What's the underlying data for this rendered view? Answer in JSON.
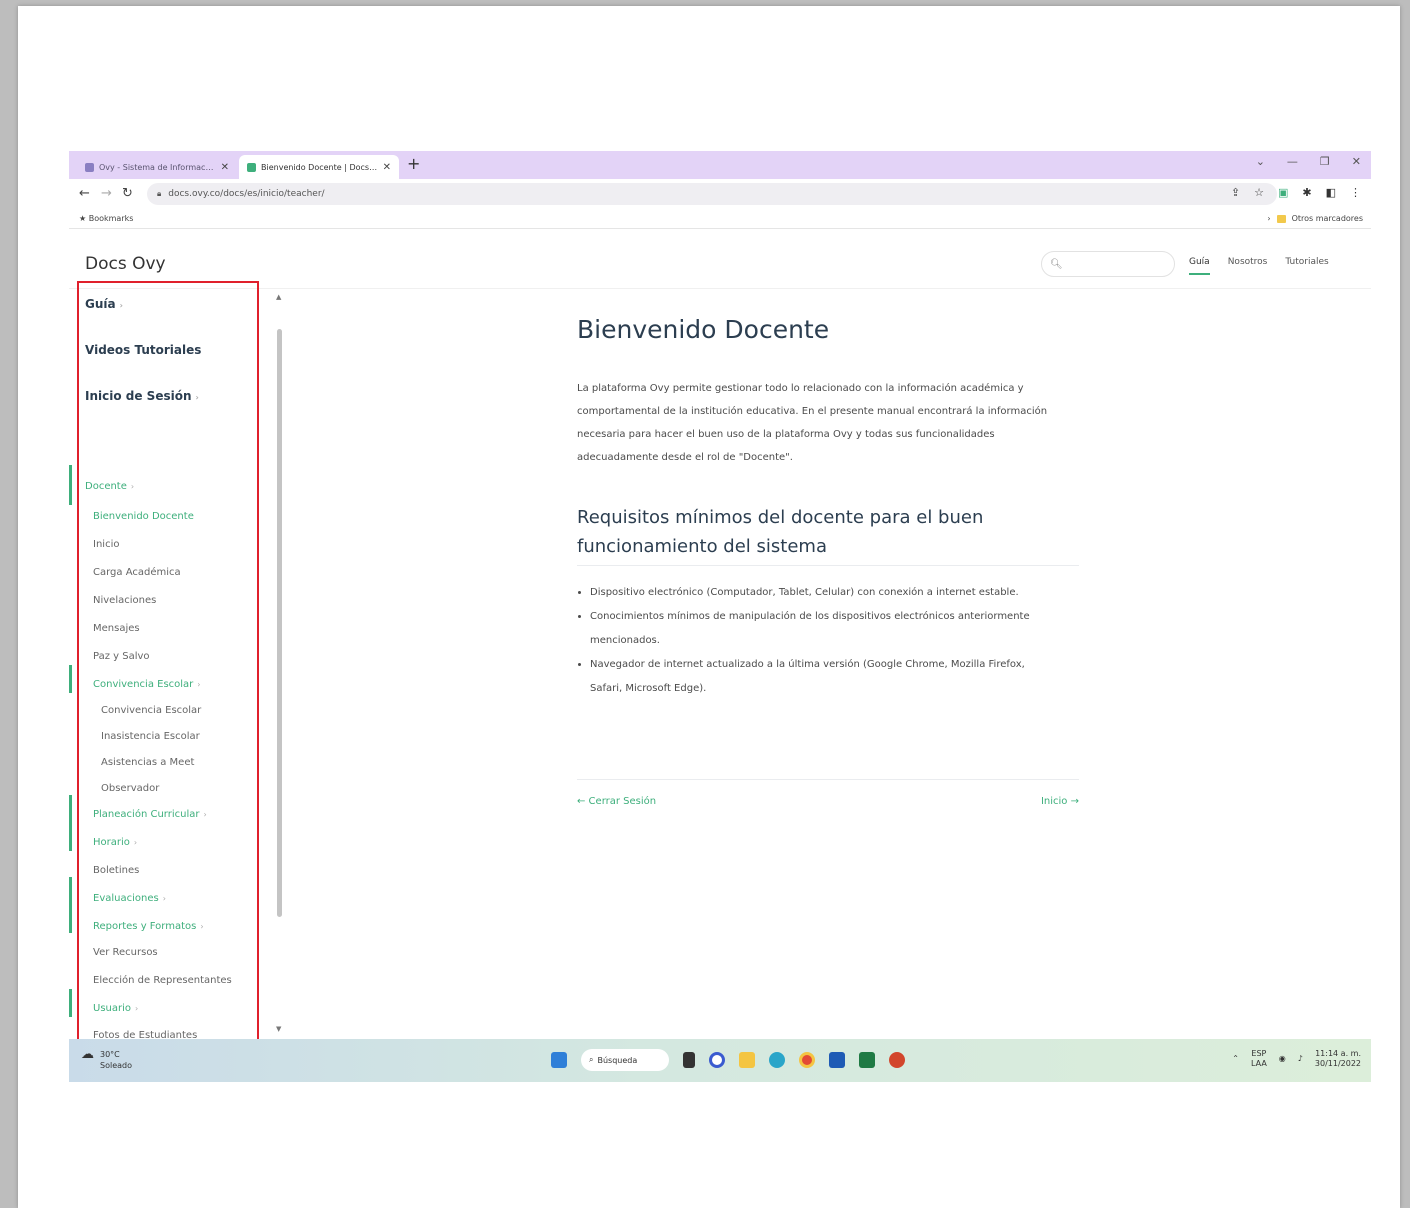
{
  "browser": {
    "tabs": [
      {
        "title": "Ovy - Sistema de Información p",
        "close": "✕"
      },
      {
        "title": "Bienvenido Docente | Docs Ovy",
        "close": "✕"
      }
    ],
    "new_tab": "+",
    "window_controls": [
      "⌄",
      "—",
      "❐",
      "✕"
    ],
    "url": "docs.ovy.co/docs/es/inicio/teacher/",
    "bookmarks_left": "Bookmarks",
    "bookmarks_right": "Otros marcadores"
  },
  "site": {
    "brand": "Docs Ovy",
    "search_placeholder": "",
    "nav": [
      "Guía",
      "Nosotros",
      "Tutoriales"
    ]
  },
  "sidebar": {
    "items": [
      {
        "label": "Guía",
        "type": "h",
        "arrow": "›"
      },
      {
        "label": "Videos Tutoriales",
        "type": "h"
      },
      {
        "label": "Inicio de Sesión",
        "type": "h",
        "arrow": "›"
      },
      {
        "label": "Docente",
        "type": "green",
        "arrow": "›"
      },
      {
        "label": "Bienvenido Docente",
        "type": "green"
      },
      {
        "label": "Inicio",
        "type": "sub"
      },
      {
        "label": "Carga Académica",
        "type": "sub"
      },
      {
        "label": "Nivelaciones",
        "type": "sub"
      },
      {
        "label": "Mensajes",
        "type": "sub"
      },
      {
        "label": "Paz y Salvo",
        "type": "sub"
      },
      {
        "label": "Convivencia Escolar",
        "type": "green",
        "arrow": "›"
      },
      {
        "label": "Convivencia Escolar",
        "type": "sub"
      },
      {
        "label": "Inasistencia Escolar",
        "type": "sub"
      },
      {
        "label": "Asistencias a Meet",
        "type": "sub"
      },
      {
        "label": "Observador",
        "type": "sub"
      },
      {
        "label": "Planeación Curricular",
        "type": "green",
        "arrow": "›"
      },
      {
        "label": "Horario",
        "type": "green",
        "arrow": "›"
      },
      {
        "label": "Boletines",
        "type": "sub"
      },
      {
        "label": "Evaluaciones",
        "type": "green",
        "arrow": "›"
      },
      {
        "label": "Reportes y Formatos",
        "type": "green",
        "arrow": "›"
      },
      {
        "label": "Ver Recursos",
        "type": "sub"
      },
      {
        "label": "Elección de Representantes",
        "type": "sub"
      },
      {
        "label": "Usuario",
        "type": "green",
        "arrow": "›"
      },
      {
        "label": "Fotos de Estudiantes",
        "type": "sub"
      }
    ]
  },
  "content": {
    "title": "Bienvenido Docente",
    "intro": "La plataforma Ovy permite gestionar todo lo relacionado con la información académica y comportamental de la institución educativa. En el presente manual encontrará la información necesaria para hacer el buen uso de la plataforma Ovy y todas sus funcionalidades adecuadamente desde el rol de \"Docente\".",
    "subtitle": "Requisitos mínimos del docente para el buen funcionamiento del sistema",
    "requirements": [
      "Dispositivo electrónico (Computador, Tablet, Celular) con conexión a internet estable.",
      "Conocimientos mínimos de manipulación de los dispositivos electrónicos anteriormente mencionados.",
      "Navegador de internet actualizado a la última versión (Google Chrome, Mozilla Firefox, Safari, Microsoft Edge)."
    ],
    "prev": "← Cerrar Sesión",
    "next": "Inicio →"
  },
  "taskbar": {
    "weather_temp": "30°C",
    "weather_desc": "Soleado",
    "search": "Búsqueda",
    "lang": "ESP",
    "lang2": "LAA",
    "time": "11:14 a. m.",
    "date": "30/11/2022"
  },
  "colors": {
    "accent": "#3eaf7c",
    "highlight_box": "#e0202c",
    "tab_strip": "#e3d3f7"
  }
}
